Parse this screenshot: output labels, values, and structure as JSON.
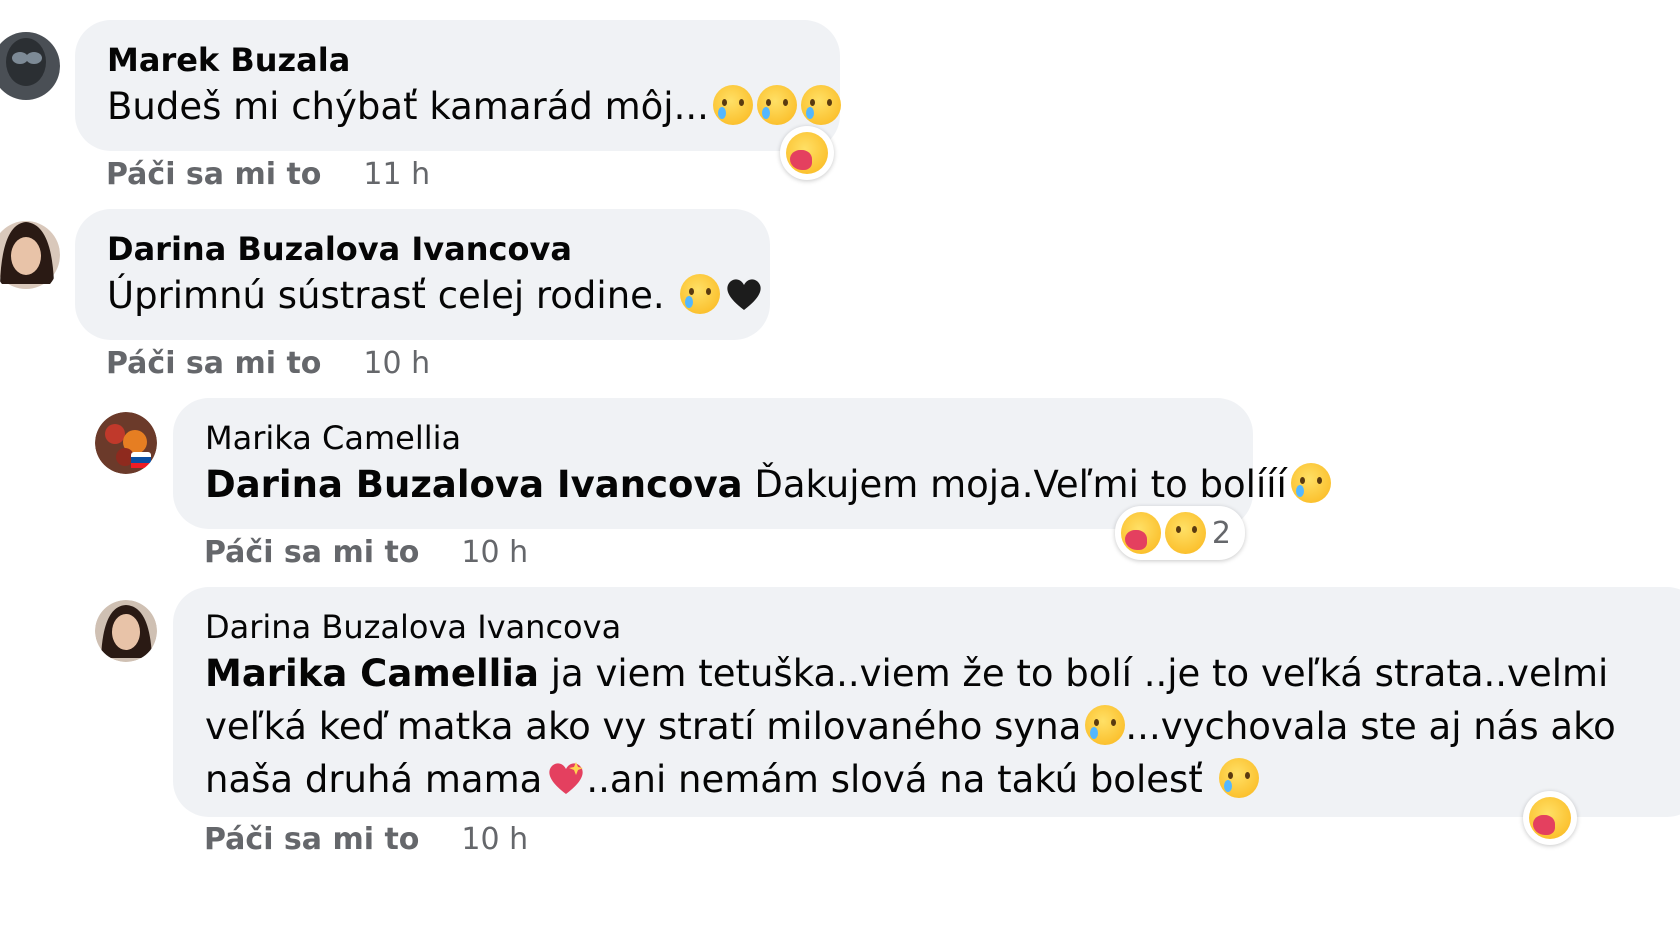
{
  "comments": [
    {
      "author": "Marek Buzala",
      "text": "Budeš mi chýbať kamarád môj...",
      "like_label": "Páči sa mi to",
      "time": "11 h"
    },
    {
      "author": "Darina Buzalova Ivancova",
      "text": "Úprimnú sústrasť celej rodine. ",
      "like_label": "Páči sa mi to",
      "time": "10 h"
    },
    {
      "author": "Marika Camellia",
      "mention": "Darina Buzalova Ivancova",
      "text": " Ďakujem moja.Veľmi to bolííí",
      "like_label": "Páči sa mi to",
      "time": "10 h",
      "reaction_count": "2"
    },
    {
      "author": "Darina Buzalova Ivancova",
      "mention": "Marika Camellia",
      "line1": " ja viem tetuška..viem že to bolí ..je to veľká strata..velmi",
      "line2a": "veľká keď matka ako vy stratí milovaného syna",
      "line2b": "...vychovala ste aj nás ako",
      "line3a": "naša druhá mama",
      "line3b": "..ani nemám slová na takú bolesť ",
      "like_label": "Páči sa mi to",
      "time": "10 h"
    }
  ],
  "colors": {
    "bubble": "#f0f2f5",
    "meta_text": "#65676b",
    "heart_dark": "#1c1c1c",
    "heart_pink": "#e4405f"
  },
  "icons": [
    "sad-cry-emoji",
    "black-heart",
    "care-reaction",
    "sad-reaction",
    "sparkling-heart"
  ]
}
